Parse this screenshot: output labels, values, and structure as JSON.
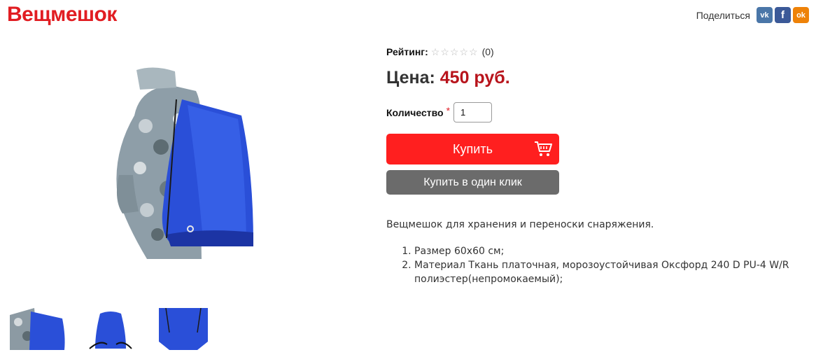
{
  "product": {
    "title": "Вещмешок"
  },
  "share": {
    "label": "Поделиться",
    "buttons": [
      {
        "name": "vk",
        "glyph": "vk",
        "color": "#4a76a8"
      },
      {
        "name": "facebook",
        "glyph": "f",
        "color": "#3b5998"
      },
      {
        "name": "odnoklassniki",
        "glyph": "ok",
        "color": "#ee8208"
      }
    ]
  },
  "gallery": {
    "main_image_icon": "backpack-photo",
    "thumbnails": [
      "backpack-worn-photo",
      "backpack-front-photo",
      "backpack-back-photo"
    ]
  },
  "rating": {
    "label": "Рейтинг:",
    "stars_total": 5,
    "stars_filled": 0,
    "count": "(0)"
  },
  "price": {
    "label": "Цена:",
    "value": "450 руб."
  },
  "quantity": {
    "label": "Количество",
    "required_mark": "*",
    "value": "1"
  },
  "buttons": {
    "buy_label": "Купить",
    "buy_color": "#ff1f1f",
    "buy_icon": "cart-icon",
    "one_click_label": "Купить в один клик",
    "one_click_color": "#6b6b6b"
  },
  "description": {
    "intro": "Вещмешок для хранения и переноски снаряжения.",
    "items": [
      "Размер 60х60 см;",
      "Материал Ткань платочная, морозоустойчивая Оксфорд 240 D PU-4 W/R полиэстер(непромокаемый);"
    ]
  },
  "colors": {
    "brand_red": "#e11d22",
    "price_red": "#b8141c"
  }
}
